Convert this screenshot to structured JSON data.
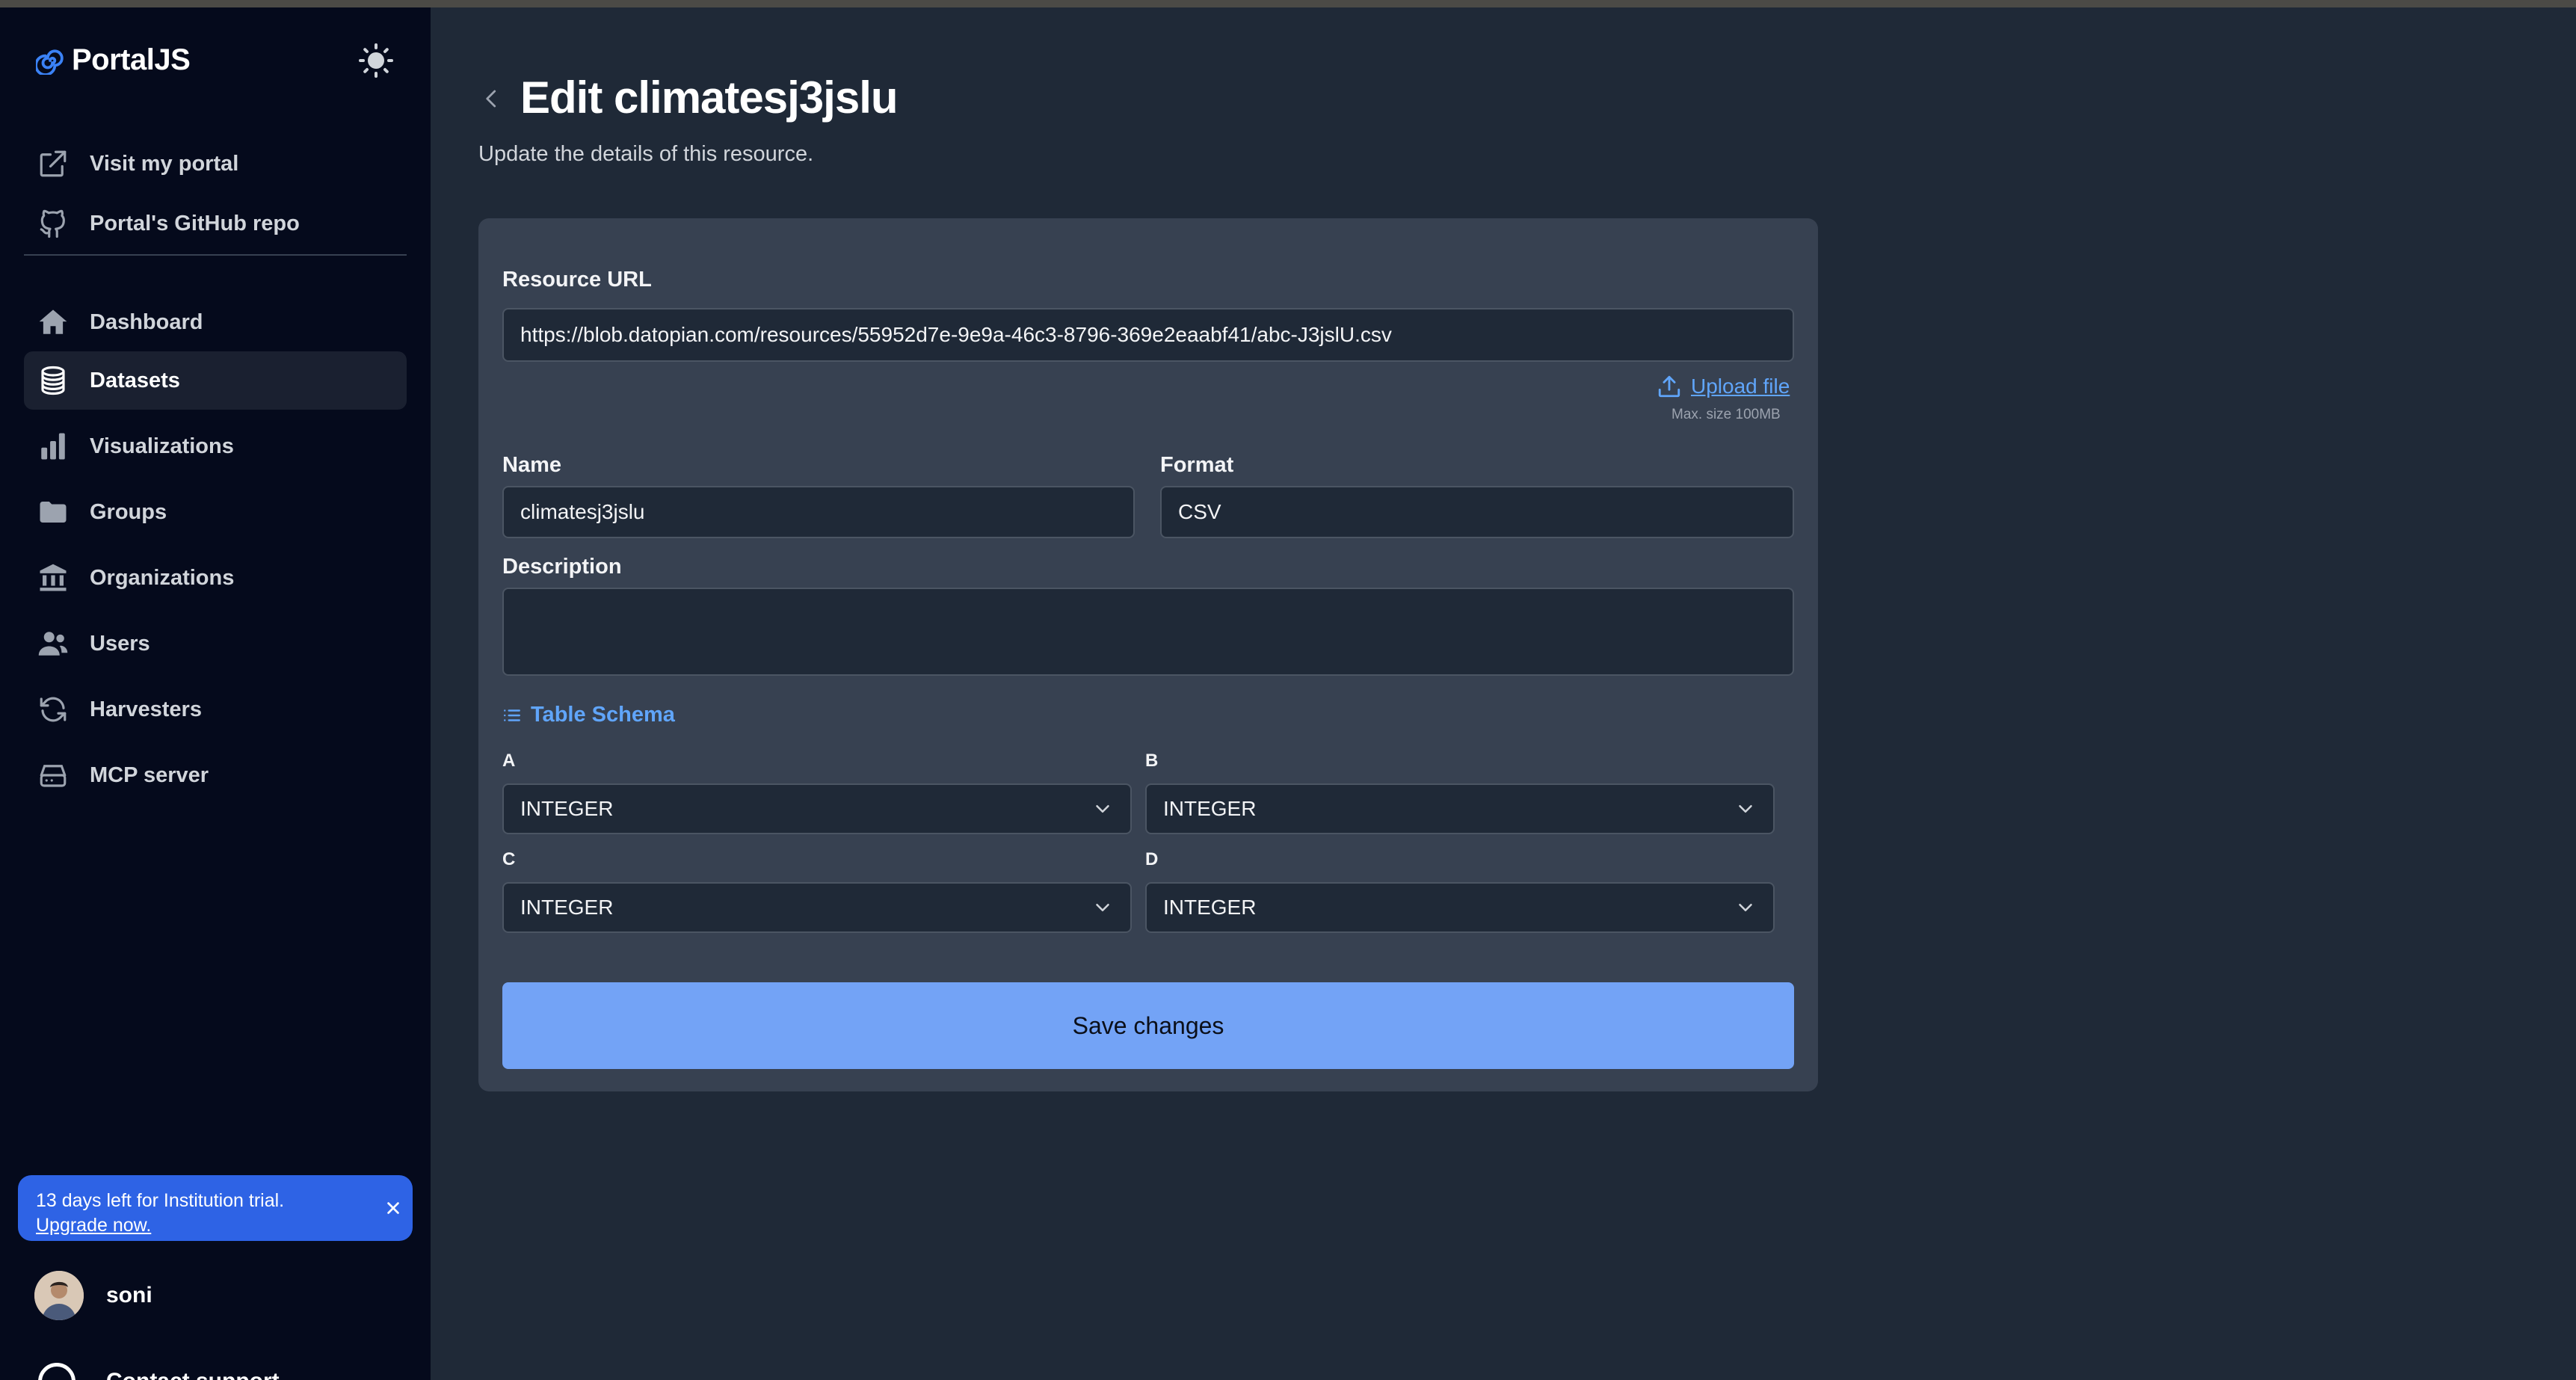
{
  "brand": {
    "name": "PortalJS"
  },
  "sidebar": {
    "links": [
      {
        "label": "Visit my portal",
        "icon": "external-link-icon"
      },
      {
        "label": "Portal's GitHub repo",
        "icon": "github-icon"
      }
    ],
    "items": [
      {
        "label": "Dashboard",
        "icon": "home-icon",
        "active": false
      },
      {
        "label": "Datasets",
        "icon": "database-icon",
        "active": true
      },
      {
        "label": "Visualizations",
        "icon": "bar-chart-icon",
        "active": false
      },
      {
        "label": "Groups",
        "icon": "folder-icon",
        "active": false
      },
      {
        "label": "Organizations",
        "icon": "bank-icon",
        "active": false
      },
      {
        "label": "Users",
        "icon": "users-icon",
        "active": false
      },
      {
        "label": "Harvesters",
        "icon": "refresh-icon",
        "active": false
      },
      {
        "label": "MCP server",
        "icon": "server-icon",
        "active": false
      }
    ],
    "trial": {
      "message": "13 days left for Institution trial.",
      "upgrade": "Upgrade now."
    },
    "user": {
      "name": "soni"
    },
    "support": {
      "label": "Contact support"
    }
  },
  "page": {
    "title": "Edit climatesj3jslu",
    "subtitle": "Update the details of this resource."
  },
  "form": {
    "resource_url_label": "Resource URL",
    "resource_url": "https://blob.datopian.com/resources/55952d7e-9e9a-46c3-8796-369e2eaabf41/abc-J3jslU.csv",
    "upload_label": "Upload file",
    "max_size": "Max. size 100MB",
    "name_label": "Name",
    "name": "climatesj3jslu",
    "format_label": "Format",
    "format": "CSV",
    "description_label": "Description",
    "description": "",
    "schema_label": "Table Schema",
    "schema": [
      {
        "column": "A",
        "type": "INTEGER"
      },
      {
        "column": "B",
        "type": "INTEGER"
      },
      {
        "column": "C",
        "type": "INTEGER"
      },
      {
        "column": "D",
        "type": "INTEGER"
      }
    ],
    "save_label": "Save changes"
  },
  "colors": {
    "sidebar_bg": "#050a1c",
    "main_bg": "#1f2937",
    "card_bg": "#374151",
    "accent": "#60a5fa",
    "save_button": "#73a3f6",
    "trial_banner": "#2e63e5"
  }
}
